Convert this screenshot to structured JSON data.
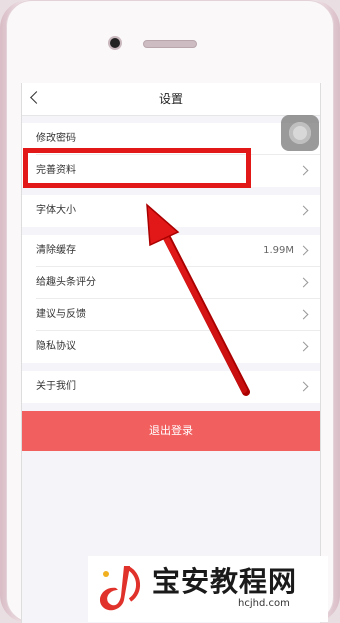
{
  "nav": {
    "title": "设置"
  },
  "settings": {
    "items": [
      {
        "label": "修改密码",
        "value": ""
      },
      {
        "label": "完善资料",
        "value": ""
      },
      {
        "label": "字体大小",
        "value": ""
      },
      {
        "label": "清除缓存",
        "value": "1.99M"
      },
      {
        "label": "给趣头条评分",
        "value": ""
      },
      {
        "label": "建议与反馈",
        "value": ""
      },
      {
        "label": "隐私协议",
        "value": ""
      },
      {
        "label": "关于我们",
        "value": ""
      }
    ]
  },
  "logout": {
    "label": "退出登录"
  },
  "annotation": {
    "highlight_target": "完善资料",
    "color": "#e21818"
  },
  "watermark": {
    "brand": "宝安教程网",
    "url": "hcjhd.com"
  },
  "colors": {
    "logout_bg": "#f25f5f",
    "screen_bg": "#f5f4f8"
  }
}
